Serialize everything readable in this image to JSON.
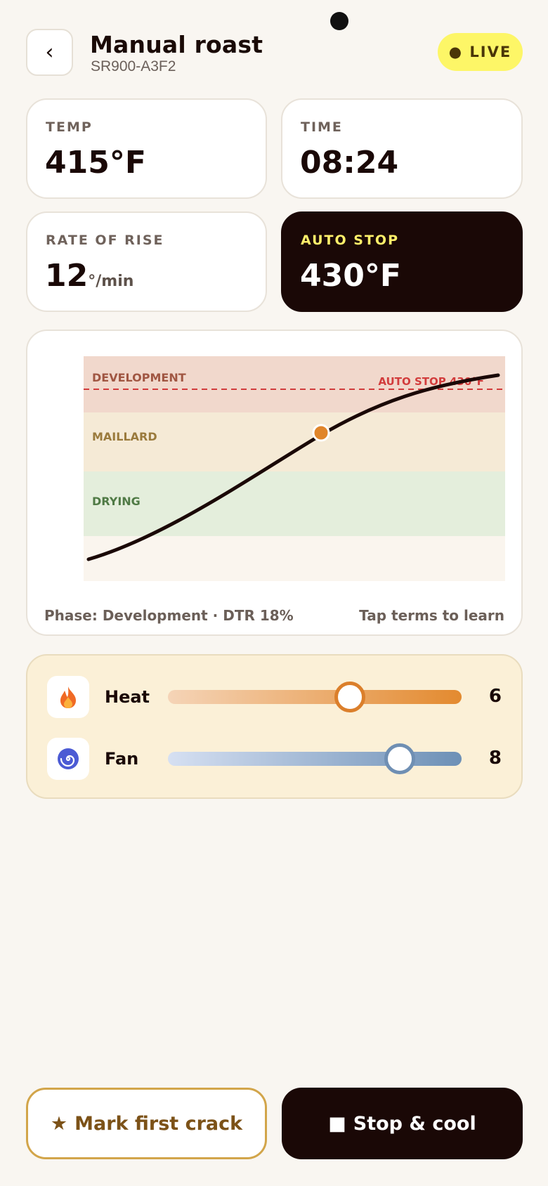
{
  "header": {
    "back_glyph": "‹",
    "title": "Manual roast",
    "subtitle": "SR900-A3F2",
    "live_label": "● LIVE"
  },
  "stats": {
    "temp": {
      "label": "TEMP",
      "value": "415°F"
    },
    "time": {
      "label": "TIME",
      "value": "08:24"
    },
    "rate_of_rise": {
      "label": "RATE OF RISE",
      "value": "12",
      "unit": "°/min"
    },
    "auto_stop": {
      "label": "AUTO STOP",
      "value": "430°F"
    }
  },
  "chart": {
    "phases": [
      {
        "name": "DEVELOPMENT",
        "color": "#f1d8cc",
        "label_color": "#a05642"
      },
      {
        "name": "MAILLARD",
        "color": "#f5ead6",
        "label_color": "#9a7a3c"
      },
      {
        "name": "DRYING",
        "color": "#e4eedc",
        "label_color": "#4f7a45"
      }
    ],
    "auto_stop_label": "AUTO STOP 430°F",
    "auto_stop_color": "#d23c3c",
    "footer_phase": "Phase: Development · DTR 18%",
    "footer_hint": "Tap terms to learn",
    "current_point_color": "#e0852a"
  },
  "controls": {
    "heat": {
      "label": "Heat",
      "value": "6",
      "level": 0.62,
      "icon": "flame-icon"
    },
    "fan": {
      "label": "Fan",
      "value": "8",
      "level": 0.79,
      "icon": "fan-spiral-icon"
    }
  },
  "actions": {
    "mark_first_crack": {
      "glyph": "★",
      "label": "Mark first crack"
    },
    "stop_cool": {
      "glyph": "■",
      "label": "Stop & cool"
    }
  },
  "colors": {
    "background": "#f9f6f1",
    "dark": "#1a0806",
    "live_badge": "#fdf667",
    "accent_yellow": "#fff06a"
  }
}
